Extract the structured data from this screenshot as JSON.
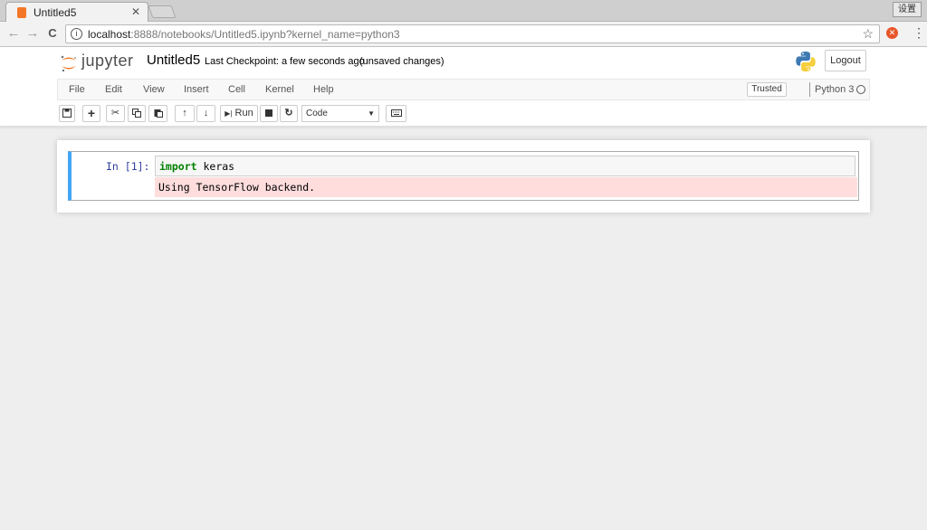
{
  "browser": {
    "tab_title": "Untitled5",
    "tab_close": "✕",
    "profile_label": "设置",
    "url_host": "localhost",
    "url_rest": ":8888/notebooks/Untitled5.ipynb?kernel_name=python3",
    "back_glyph": "←",
    "forward_glyph": "→",
    "reload_glyph": "C",
    "info_glyph": "i",
    "star_glyph": "☆",
    "menu_glyph": "⋮"
  },
  "header": {
    "logo_text": "jupyter",
    "notebook_name": "Untitled5",
    "checkpoint": "Last Checkpoint: a few seconds ago",
    "autosave": "(unsaved changes)",
    "logout": "Logout"
  },
  "menubar": {
    "items": [
      "File",
      "Edit",
      "View",
      "Insert",
      "Cell",
      "Kernel",
      "Help"
    ],
    "trusted": "Trusted",
    "kernel_name": "Python 3"
  },
  "toolbar": {
    "run_label": "Run",
    "cell_type": "Code"
  },
  "cell": {
    "prompt": "In [1]:",
    "code_keyword": "import",
    "code_rest": " keras",
    "output": "Using TensorFlow backend."
  },
  "colors": {
    "accent": "#42a5f5",
    "jupyter_orange": "#f37726",
    "stderr_bg": "#ffdddd"
  }
}
